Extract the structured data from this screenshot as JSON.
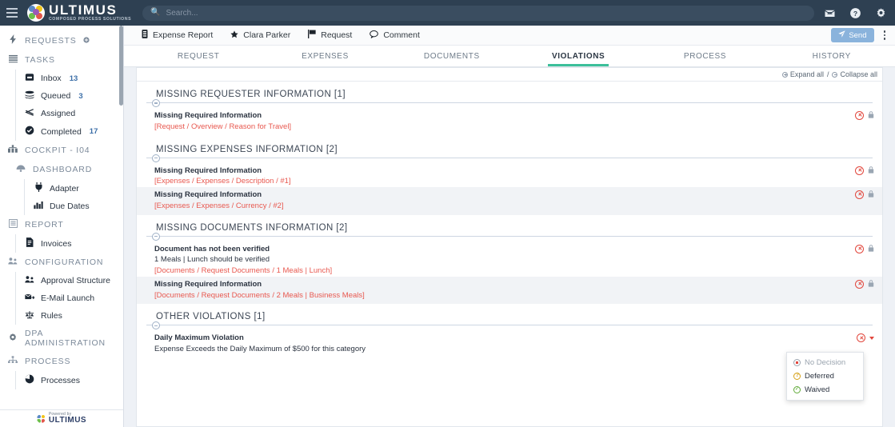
{
  "app": {
    "brand_name": "ULTIMUS",
    "brand_tagline": "COMPOSED PROCESS SOLUTIONS",
    "menu_icon": "hamburger-icon"
  },
  "search": {
    "placeholder": "Search...",
    "value": "",
    "icon": "search-icon"
  },
  "top_icons": [
    {
      "name": "mail-icon",
      "glyph": "✉"
    },
    {
      "name": "help-icon",
      "glyph": "?"
    },
    {
      "name": "gear-icon",
      "glyph": "⚙"
    }
  ],
  "sidebar": {
    "groups": [
      {
        "label": "REQUESTS",
        "icon": "bolt-icon",
        "glyph": "⚡",
        "has_add": true,
        "items": []
      },
      {
        "label": "TASKS",
        "icon": "tasks-icon",
        "glyph": "☰",
        "has_add": false,
        "items": [
          {
            "label": "Inbox",
            "count": "13",
            "icon": "inbox-icon",
            "glyph": "⏷"
          },
          {
            "label": "Queued",
            "count": "3",
            "icon": "layers-icon",
            "glyph": "☰"
          },
          {
            "label": "Assigned",
            "count": "",
            "icon": "share-icon",
            "glyph": "⤳"
          },
          {
            "label": "Completed",
            "count": "17",
            "icon": "check-circle-icon",
            "glyph": "✔"
          }
        ]
      },
      {
        "label": "COCKPIT - I04",
        "icon": "cockpit-icon",
        "glyph": "☷",
        "has_add": false,
        "items": []
      },
      {
        "label": "DASHBOARD",
        "icon": "dashboard-icon",
        "glyph": "◔",
        "indent": true,
        "has_add": false,
        "items": [
          {
            "label": "Adapter",
            "count": "",
            "icon": "plug-icon",
            "glyph": "⑂"
          },
          {
            "label": "Due Dates",
            "count": "",
            "icon": "bar-chart-icon",
            "glyph": "█"
          }
        ]
      },
      {
        "label": "REPORT",
        "icon": "report-icon",
        "glyph": "☰",
        "has_add": false,
        "items": [
          {
            "label": "Invoices",
            "count": "",
            "icon": "document-icon",
            "glyph": "☷"
          }
        ]
      },
      {
        "label": "CONFIGURATION",
        "icon": "config-icon",
        "glyph": "⚙",
        "has_add": false,
        "items": [
          {
            "label": "Approval Structure",
            "count": "",
            "icon": "people-icon",
            "glyph": "⚇"
          },
          {
            "label": "E-Mail Launch",
            "count": "",
            "icon": "email-launch-icon",
            "glyph": "✉"
          },
          {
            "label": "Rules",
            "count": "",
            "icon": "scales-icon",
            "glyph": "⚖"
          }
        ]
      },
      {
        "label": "DPA ADMINISTRATION",
        "icon": "admin-gear-icon",
        "glyph": "⚙",
        "has_add": false,
        "items": []
      },
      {
        "label": "PROCESS",
        "icon": "process-icon",
        "glyph": "⑂",
        "has_add": false,
        "items": [
          {
            "label": "Processes",
            "count": "",
            "icon": "pie-chart-icon",
            "glyph": "◕"
          }
        ]
      }
    ],
    "footer": {
      "powered_by": "Powered by",
      "brand": "ULTIMUS"
    }
  },
  "breadcrumb": {
    "items": [
      {
        "label": "Expense Report",
        "icon": "form-icon",
        "glyph": "☰"
      },
      {
        "label": "Clara Parker",
        "icon": "star-icon",
        "glyph": "★"
      },
      {
        "label": "Request",
        "icon": "flag-icon",
        "glyph": "⚑"
      },
      {
        "label": "Comment",
        "icon": "comment-icon",
        "glyph": "὞9"
      }
    ],
    "send_label": "Send",
    "send_icon": "send-icon",
    "kebab_icon": "more-vertical-icon"
  },
  "tabs": [
    {
      "label": "REQUEST",
      "active": false
    },
    {
      "label": "EXPENSES",
      "active": false
    },
    {
      "label": "DOCUMENTS",
      "active": false
    },
    {
      "label": "VIOLATIONS",
      "active": true
    },
    {
      "label": "PROCESS",
      "active": false
    },
    {
      "label": "HISTORY",
      "active": false
    }
  ],
  "panel": {
    "expand_all_label": "Expand all",
    "separator": "/",
    "collapse_all_label": "Collapse all",
    "groups": [
      {
        "title": "MISSING REQUESTER INFORMATION [1]",
        "rows": [
          {
            "title": "Missing Required Information",
            "sub": "",
            "path": "[Request / Overview / Reason for Travel]",
            "alt": false,
            "actions": [
              "ban-icon",
              "lock-icon"
            ]
          }
        ]
      },
      {
        "title": "MISSING EXPENSES INFORMATION [2]",
        "rows": [
          {
            "title": "Missing Required Information",
            "sub": "",
            "path": "[Expenses / Expenses / Description / #1]",
            "alt": false,
            "actions": [
              "ban-icon",
              "lock-icon"
            ]
          },
          {
            "title": "Missing Required Information",
            "sub": "",
            "path": "[Expenses / Expenses / Currency / #2]",
            "alt": true,
            "actions": [
              "ban-icon",
              "lock-icon"
            ]
          }
        ]
      },
      {
        "title": "MISSING DOCUMENTS INFORMATION [2]",
        "rows": [
          {
            "title": "Document has not been verified",
            "sub": "1 Meals | Lunch should be verified",
            "path": "[Documents / Request Documents / 1 Meals | Lunch]",
            "alt": false,
            "actions": [
              "ban-icon",
              "lock-icon"
            ]
          },
          {
            "title": "Missing Required Information",
            "sub": "",
            "path": "[Documents / Request Documents / 2 Meals | Business Meals]",
            "alt": true,
            "actions": [
              "ban-icon",
              "lock-icon"
            ]
          }
        ]
      },
      {
        "title": "OTHER VIOLATIONS [1]",
        "rows": [
          {
            "title": "Daily Maximum Violation",
            "sub": "Expense Exceeds the Daily Maximum of $500 for this category",
            "path": "",
            "alt": false,
            "actions": [
              "ban-icon",
              "caret-down-icon"
            ]
          }
        ]
      }
    ]
  },
  "decision_dropdown": {
    "open": true,
    "options": [
      {
        "label": "No Decision",
        "state": "muted",
        "icon": "no-decision-icon"
      },
      {
        "label": "Deferred",
        "state": "normal",
        "icon": "deferred-icon"
      },
      {
        "label": "Waived",
        "state": "normal",
        "icon": "waived-icon"
      }
    ]
  },
  "colors": {
    "topbar": "#2e4052",
    "accent_teal": "#3cbf9a",
    "danger_red": "#e2473d",
    "send_blue": "#8ab3dc",
    "deferred_amber": "#d6a117",
    "waived_green": "#5eaa36"
  }
}
